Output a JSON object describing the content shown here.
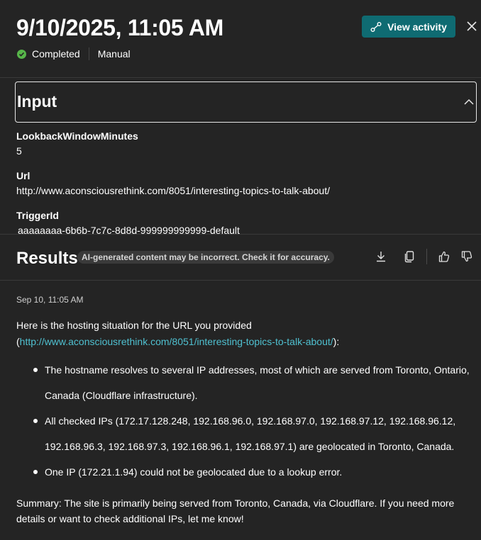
{
  "header": {
    "title": "9/10/2025, 11:05 AM",
    "status": "Completed",
    "mode": "Manual",
    "view_activity": "View activity"
  },
  "input": {
    "title": "Input",
    "fields": [
      {
        "label": "LookbackWindowMinutes",
        "value": "5"
      },
      {
        "label": "Url",
        "value": "http://www.aconsciousrethink.com/8051/interesting-topics-to-talk-about/"
      },
      {
        "label": "TriggerId",
        "value": "aaaaaaaa-6b6b-7c7c-8d8d-999999999999-default"
      }
    ]
  },
  "results": {
    "title": "Results",
    "ai_notice": "AI-generated content may be incorrect. Check it for accuracy.",
    "timestamp": "Sep 10, 11:05 AM",
    "intro_prefix": "Here is the hosting situation for the URL you provided (",
    "intro_link": "http://www.aconsciousrethink.com/8051/interesting-topics-to-talk-about/",
    "intro_suffix": "):",
    "bullets": [
      "The hostname resolves to several IP addresses, most of which are served from Toronto, Ontario, Canada (Cloudflare infrastructure).",
      "All checked IPs (172.17.128.248, 192.168.96.0, 192.168.97.0, 192.168.97.12, 192.168.96.12, 192.168.96.3, 192.168.97.3, 192.168.96.1, 192.168.97.1) are geolocated in Toronto, Canada.",
      "One IP (172.21.1.94) could not be geolocated due to a lookup error."
    ],
    "summary": "Summary: The site is primarily being served from Toronto, Canada, via Cloudflare. If you need more details or want to check additional IPs, let me know!"
  },
  "icons": {
    "status": "check-circle-icon",
    "view_activity": "activity-icon",
    "close": "close-icon",
    "collapse": "chevron-up-icon",
    "download": "download-icon",
    "copy": "copy-icon",
    "thumbs_up": "thumbs-up-icon",
    "thumbs_down": "thumbs-down-icon"
  },
  "colors": {
    "background": "#242424",
    "accent_button": "#0f6b72",
    "link": "#4fc0d0",
    "success": "#57b64a"
  }
}
